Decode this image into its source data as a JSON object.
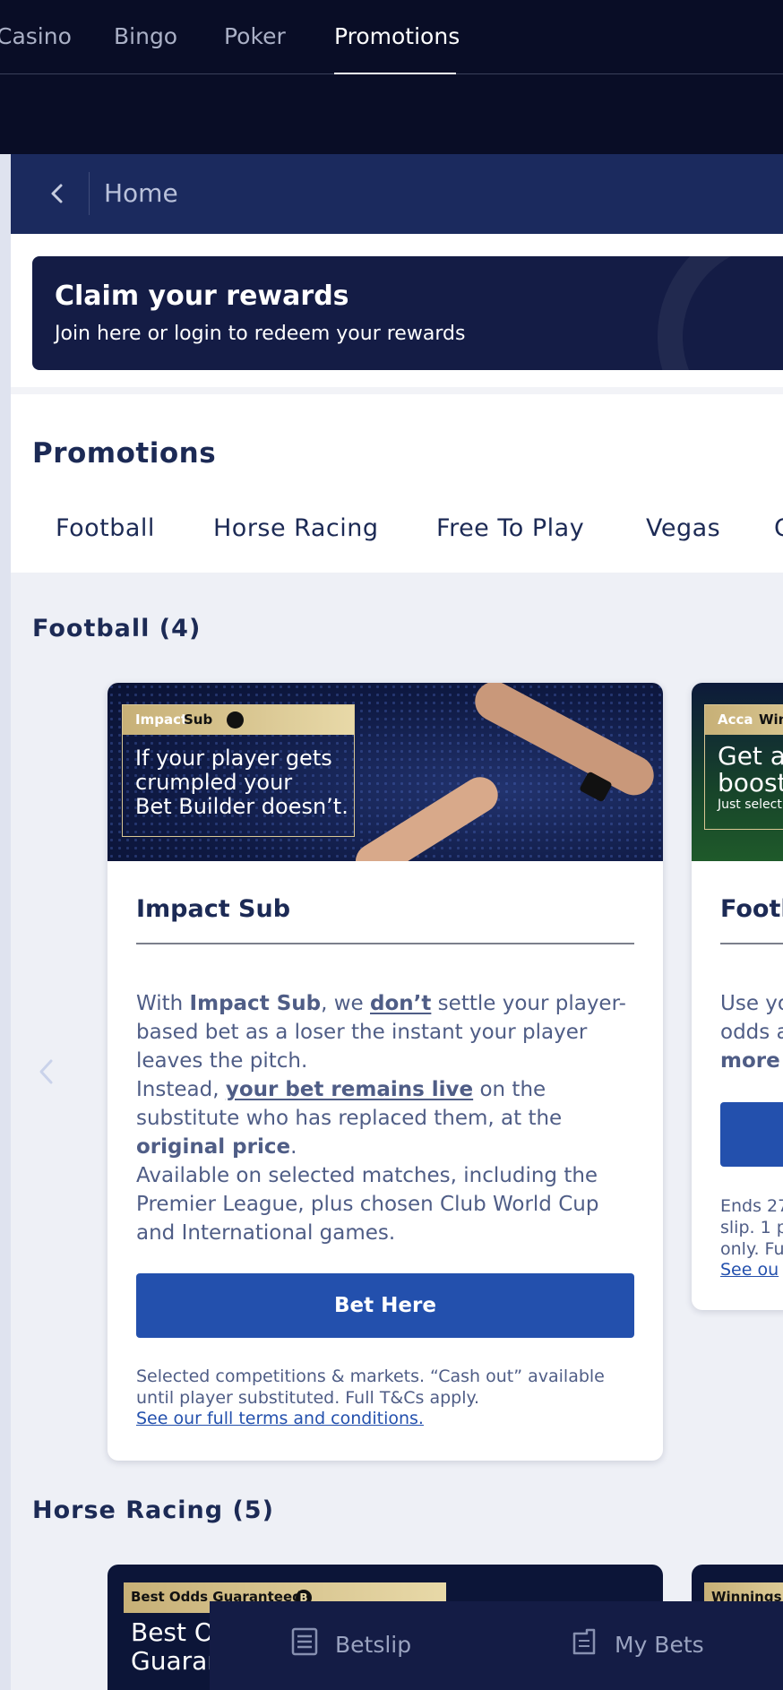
{
  "top_nav": {
    "tabs": [
      {
        "label": "Casino"
      },
      {
        "label": "Bingo"
      },
      {
        "label": "Poker"
      },
      {
        "label": "Promotions",
        "active": true
      }
    ]
  },
  "breadcrumb": {
    "label": "Home"
  },
  "rewards_banner": {
    "title": "Claim your rewards",
    "subtitle": "Join here or login to redeem your rewards"
  },
  "promotions": {
    "title": "Promotions",
    "filters": [
      "Football",
      "Horse Racing",
      "Free To Play",
      "Vegas",
      "C"
    ]
  },
  "sections": {
    "football": {
      "title": "Football (4)",
      "cards": [
        {
          "badge_a": "Impact",
          "badge_b": "Sub",
          "hero_text": [
            "If your player gets",
            "crumpled your",
            "Bet Builder doesn’t."
          ],
          "title": "Impact Sub",
          "body": {
            "p1_a": "With ",
            "p1_b": "Impact Sub",
            "p1_c": ", we ",
            "p1_d": "don’t",
            "p1_e": " settle your player-based bet as a loser the instant your player leaves the pitch.",
            "p2_a": "Instead, ",
            "p2_b": "your bet remains live",
            "p2_c": " on the substitute who has replaced them, at the ",
            "p2_d": "original price",
            "p2_e": ".",
            "p3": "Available on selected matches, including the Premier League, plus chosen Club World Cup and International games."
          },
          "button": "Bet Here",
          "small_print": "Selected competitions & markets. “Cash out” available until player substituted. Full T&Cs apply.",
          "terms_link": "See our full terms and conditions."
        },
        {
          "badge_a": "Acca",
          "badge_b": "Winni",
          "hero_text": [
            "Get a",
            "boost"
          ],
          "hero_small": "Just select a",
          "title": "Footb",
          "body_lines": [
            "Use yo",
            "odds a",
            "more"
          ],
          "small_lines": [
            "Ends 27",
            "slip. 1 p",
            "only. Fu"
          ],
          "terms_link": "See ou"
        }
      ]
    },
    "horse_racing": {
      "title": "Horse Racing (5)",
      "cards": [
        {
          "badge": "Best Odds Guaranteed",
          "badge_icon": "B",
          "big_text": [
            "Best O",
            "Guarar"
          ]
        },
        {
          "badge": "Winnings B"
        }
      ]
    }
  },
  "bottom_bar": {
    "betslip": "Betslip",
    "my_bets": "My Bets"
  },
  "colors": {
    "nav_bg": "#090d26",
    "breadcrumb_bg": "#1b2a5e",
    "primary_button": "#2350ad",
    "heading_text": "#1c2a55",
    "gold_badge": "#d9c795"
  }
}
